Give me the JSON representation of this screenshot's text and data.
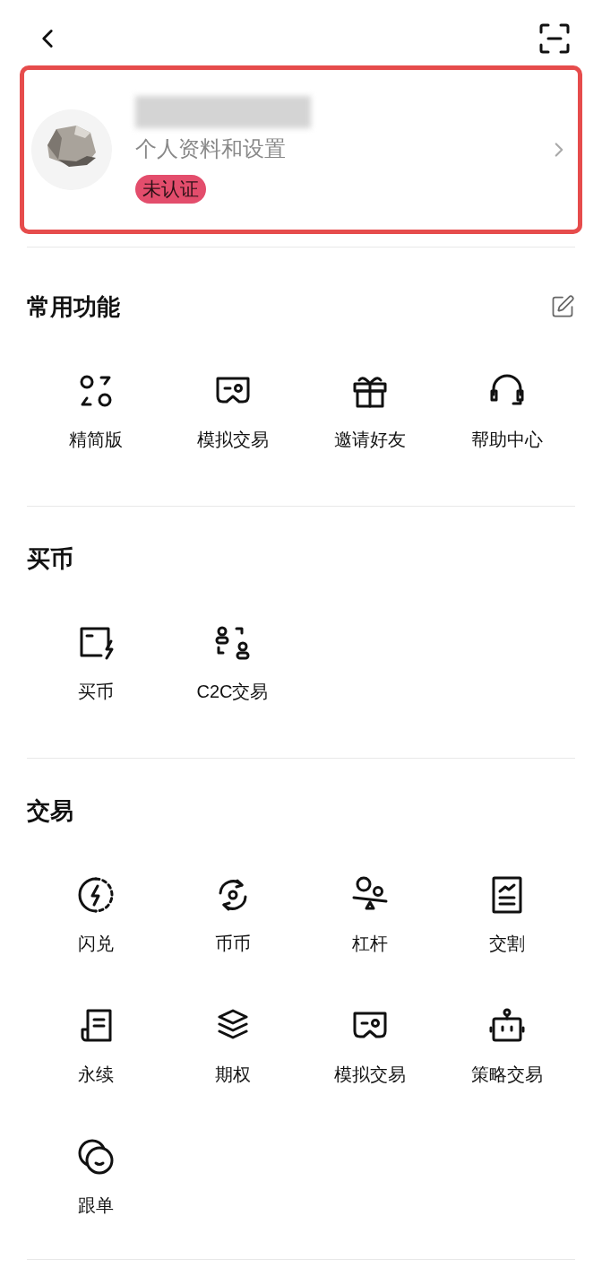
{
  "profile": {
    "subtitle": "个人资料和设置",
    "badge": "未认证"
  },
  "sections": [
    {
      "title": "常用功能",
      "editable": true,
      "items": [
        {
          "label": "精简版"
        },
        {
          "label": "模拟交易"
        },
        {
          "label": "邀请好友"
        },
        {
          "label": "帮助中心"
        }
      ]
    },
    {
      "title": "买币",
      "editable": false,
      "items": [
        {
          "label": "买币"
        },
        {
          "label": "C2C交易"
        }
      ]
    },
    {
      "title": "交易",
      "editable": false,
      "items": [
        {
          "label": "闪兑"
        },
        {
          "label": "币币"
        },
        {
          "label": "杠杆"
        },
        {
          "label": "交割"
        },
        {
          "label": "永续"
        },
        {
          "label": "期权"
        },
        {
          "label": "模拟交易"
        },
        {
          "label": "策略交易"
        },
        {
          "label": "跟单"
        }
      ]
    }
  ]
}
